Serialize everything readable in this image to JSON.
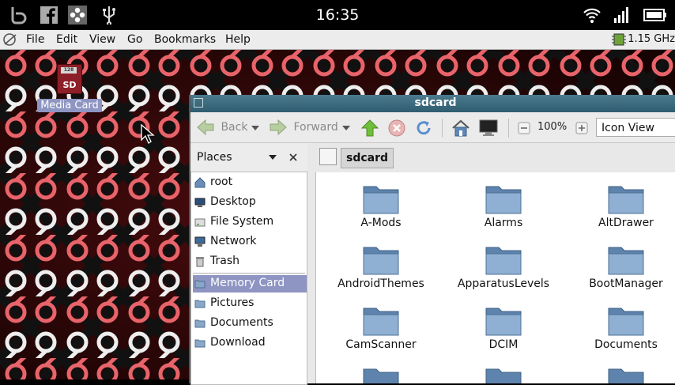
{
  "status_bar": {
    "time": "16:35",
    "left_icons": [
      "b-logo-icon",
      "facebook-icon",
      "usb-debug-icon",
      "usb-icon"
    ],
    "right_icons": [
      "wifi-icon",
      "signal-icon",
      "battery-icon"
    ]
  },
  "menubar": {
    "items": [
      "File",
      "Edit",
      "View",
      "Go",
      "Bookmarks",
      "Help"
    ],
    "cpu_freq": "1.15 GHz"
  },
  "desktop": {
    "icon_label": "Media Card",
    "sd_card_capacity": "128",
    "sd_card_text": "SD"
  },
  "window": {
    "title": "sdcard",
    "toolbar": {
      "back_label": "Back",
      "forward_label": "Forward",
      "zoom": "100%",
      "view_mode": "Icon View"
    },
    "sidebar": {
      "header": "Places",
      "items": [
        {
          "label": "root",
          "icon": "home-icon"
        },
        {
          "label": "Desktop",
          "icon": "desktop-icon"
        },
        {
          "label": "File System",
          "icon": "drive-icon"
        },
        {
          "label": "Network",
          "icon": "network-icon"
        },
        {
          "label": "Trash",
          "icon": "trash-icon"
        },
        {
          "label": "Memory Card",
          "icon": "folder-icon"
        },
        {
          "label": "Pictures",
          "icon": "folder-icon"
        },
        {
          "label": "Documents",
          "icon": "folder-icon"
        },
        {
          "label": "Download",
          "icon": "folder-icon"
        }
      ]
    },
    "path": "sdcard",
    "folders": [
      "A-Mods",
      "Alarms",
      "AltDrawer",
      "AndroidThemes",
      "ApparatusLevels",
      "BootManager",
      "CamScanner",
      "DCIM",
      "Documents"
    ]
  },
  "colors": {
    "titlebar": "#3a6a7d",
    "selection": "#8e95c2",
    "folder": "#6f93b8"
  }
}
